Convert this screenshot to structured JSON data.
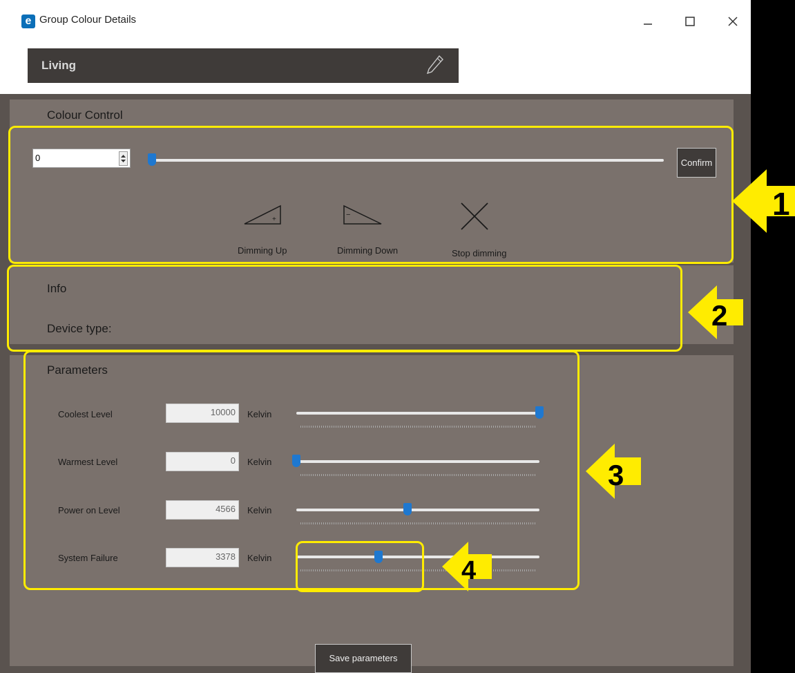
{
  "window": {
    "title": "Group Colour Details",
    "icon": "e-app-icon",
    "controls": [
      "minimize-icon",
      "maximize-icon",
      "close-icon"
    ]
  },
  "group": {
    "name": "Living",
    "edit_icon": "pencil-icon"
  },
  "colour_control": {
    "title": "Colour Control",
    "spin_value": "0",
    "slider_value": 0,
    "confirm_label": "Confirm",
    "dimming": {
      "up_label": "Dimming Up",
      "down_label": "Dimming Down",
      "stop_label": "Stop dimming"
    }
  },
  "info": {
    "title": "Info",
    "device_type_label": "Device type:"
  },
  "parameters": {
    "title": "Parameters",
    "range": [
      0,
      10000
    ],
    "rows": [
      {
        "label": "Coolest Level",
        "value": "10000",
        "unit": "Kelvin",
        "level": 10000
      },
      {
        "label": "Warmest Level",
        "value": "0",
        "unit": "Kelvin",
        "level": 0
      },
      {
        "label": "Power on Level",
        "value": "4566",
        "unit": "Kelvin",
        "level": 4566
      },
      {
        "label": "System Failure",
        "value": "3378",
        "unit": "Kelvin",
        "level": 3378
      }
    ]
  },
  "save_label": "Save parameters",
  "annotations": {
    "color": "#ffec00",
    "numbers": [
      "1",
      "2",
      "3",
      "4"
    ]
  },
  "colors": {
    "accent": "#1e78d0",
    "panel": "#7a716c",
    "background": "#5a534f",
    "dark_button": "#3f3b39"
  }
}
